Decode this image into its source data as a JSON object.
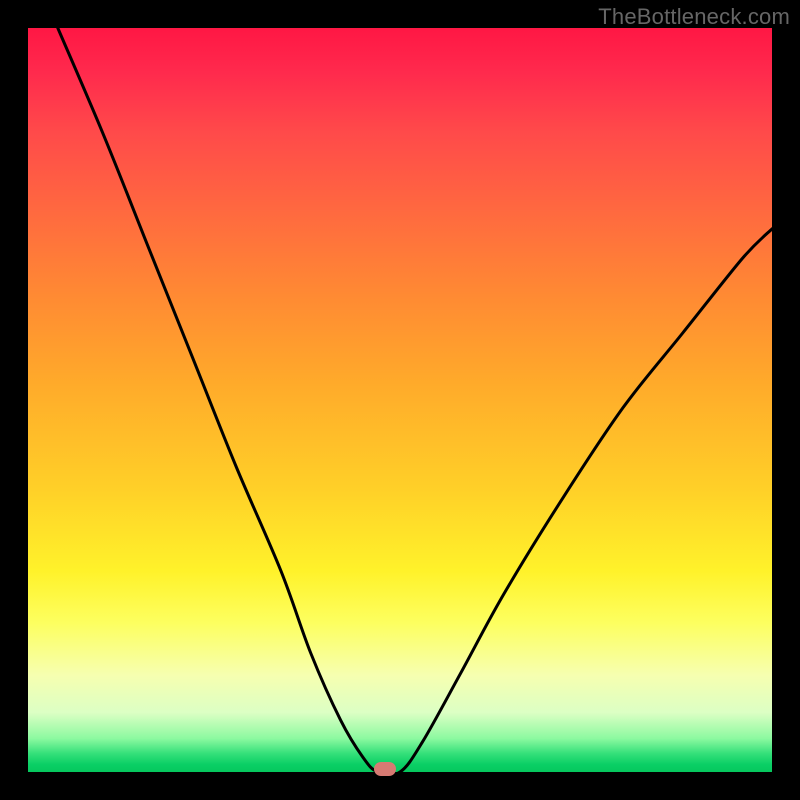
{
  "watermark": "TheBottleneck.com",
  "chart_data": {
    "type": "line",
    "title": "",
    "xlabel": "",
    "ylabel": "",
    "xlim": [
      0,
      100
    ],
    "ylim": [
      0,
      100
    ],
    "grid": false,
    "legend": false,
    "background_gradient": {
      "top_color": "#ff1744",
      "mid_color": "#ffd028",
      "bottom_color": "#06c85e",
      "meaning": "red = high bottleneck, green = low bottleneck"
    },
    "series": [
      {
        "name": "bottleneck-curve",
        "color": "#000000",
        "points": [
          {
            "x": 4,
            "y": 100
          },
          {
            "x": 10,
            "y": 86
          },
          {
            "x": 16,
            "y": 71
          },
          {
            "x": 22,
            "y": 56
          },
          {
            "x": 28,
            "y": 41
          },
          {
            "x": 34,
            "y": 27
          },
          {
            "x": 38,
            "y": 16
          },
          {
            "x": 42,
            "y": 7
          },
          {
            "x": 45,
            "y": 2
          },
          {
            "x": 47,
            "y": 0
          },
          {
            "x": 50,
            "y": 0
          },
          {
            "x": 53,
            "y": 4
          },
          {
            "x": 58,
            "y": 13
          },
          {
            "x": 64,
            "y": 24
          },
          {
            "x": 72,
            "y": 37
          },
          {
            "x": 80,
            "y": 49
          },
          {
            "x": 88,
            "y": 59
          },
          {
            "x": 96,
            "y": 69
          },
          {
            "x": 100,
            "y": 73
          }
        ]
      }
    ],
    "marker": {
      "name": "optimal-point",
      "x": 48,
      "y": 0,
      "color": "#d77a73"
    }
  }
}
